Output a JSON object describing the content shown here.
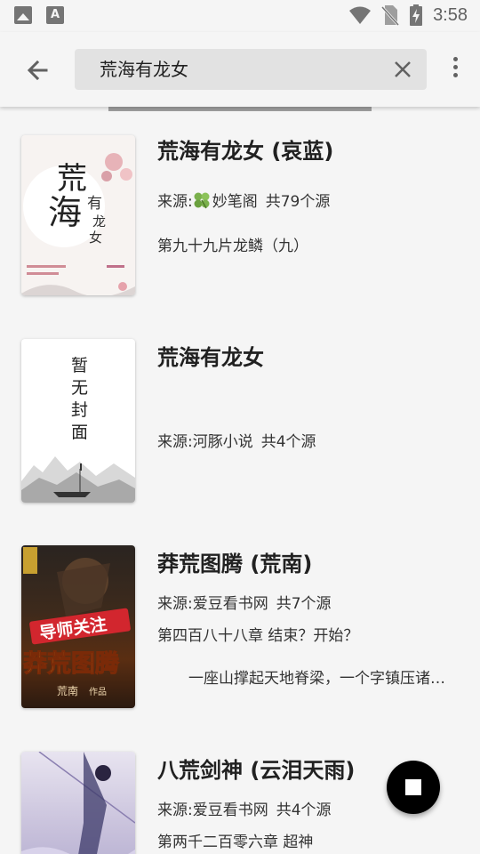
{
  "status_bar": {
    "time": "3:58",
    "icons": [
      "image-icon",
      "font-a-icon",
      "wifi-icon",
      "no-sim-icon",
      "battery-charging-icon"
    ]
  },
  "toolbar": {
    "back_icon": "arrow-left-icon",
    "search_value": "荒海有龙女",
    "clear_icon": "close-icon",
    "more_icon": "more-vert-icon"
  },
  "results": [
    {
      "title": "荒海有龙女 (哀蓝)",
      "source_prefix": "来源: ",
      "source_name": "妙笔阁",
      "source_icon": "clover-icon",
      "source_count": "共79个源",
      "latest": "第九十九片龙鳞（九）",
      "intro": "",
      "cover_text": [
        "荒",
        "海",
        "有",
        "龙",
        "女"
      ]
    },
    {
      "title": "荒海有龙女",
      "source_prefix": "来源: ",
      "source_name": "河豚小说",
      "source_count": "共4个源",
      "latest": "",
      "intro": "",
      "cover_text": [
        "暂",
        "无",
        "封",
        "面"
      ]
    },
    {
      "title": "莽荒图腾 (荒南)",
      "source_prefix": "来源: ",
      "source_name": "爱豆看书网",
      "source_count": "共7个源",
      "latest": "第四百八十八章 结束？开始？",
      "intro": "一座山撑起天地脊梁，一个字镇压诸天万界",
      "cover_text": [
        "导师关注",
        "莽荒图腾",
        "荒南",
        "作品"
      ]
    },
    {
      "title": "八荒剑神 (云泪天雨)",
      "source_prefix": "来源: ",
      "source_name": "爱豆看书网",
      "source_count": "共4个源",
      "latest": "第两千二百零六章 超神",
      "intro": "",
      "cover_text": []
    }
  ],
  "fab": {
    "icon": "stop-icon"
  },
  "colors": {
    "background": "#f5f5f5",
    "search_bg": "#e2e2e2",
    "fab": "#000000"
  }
}
